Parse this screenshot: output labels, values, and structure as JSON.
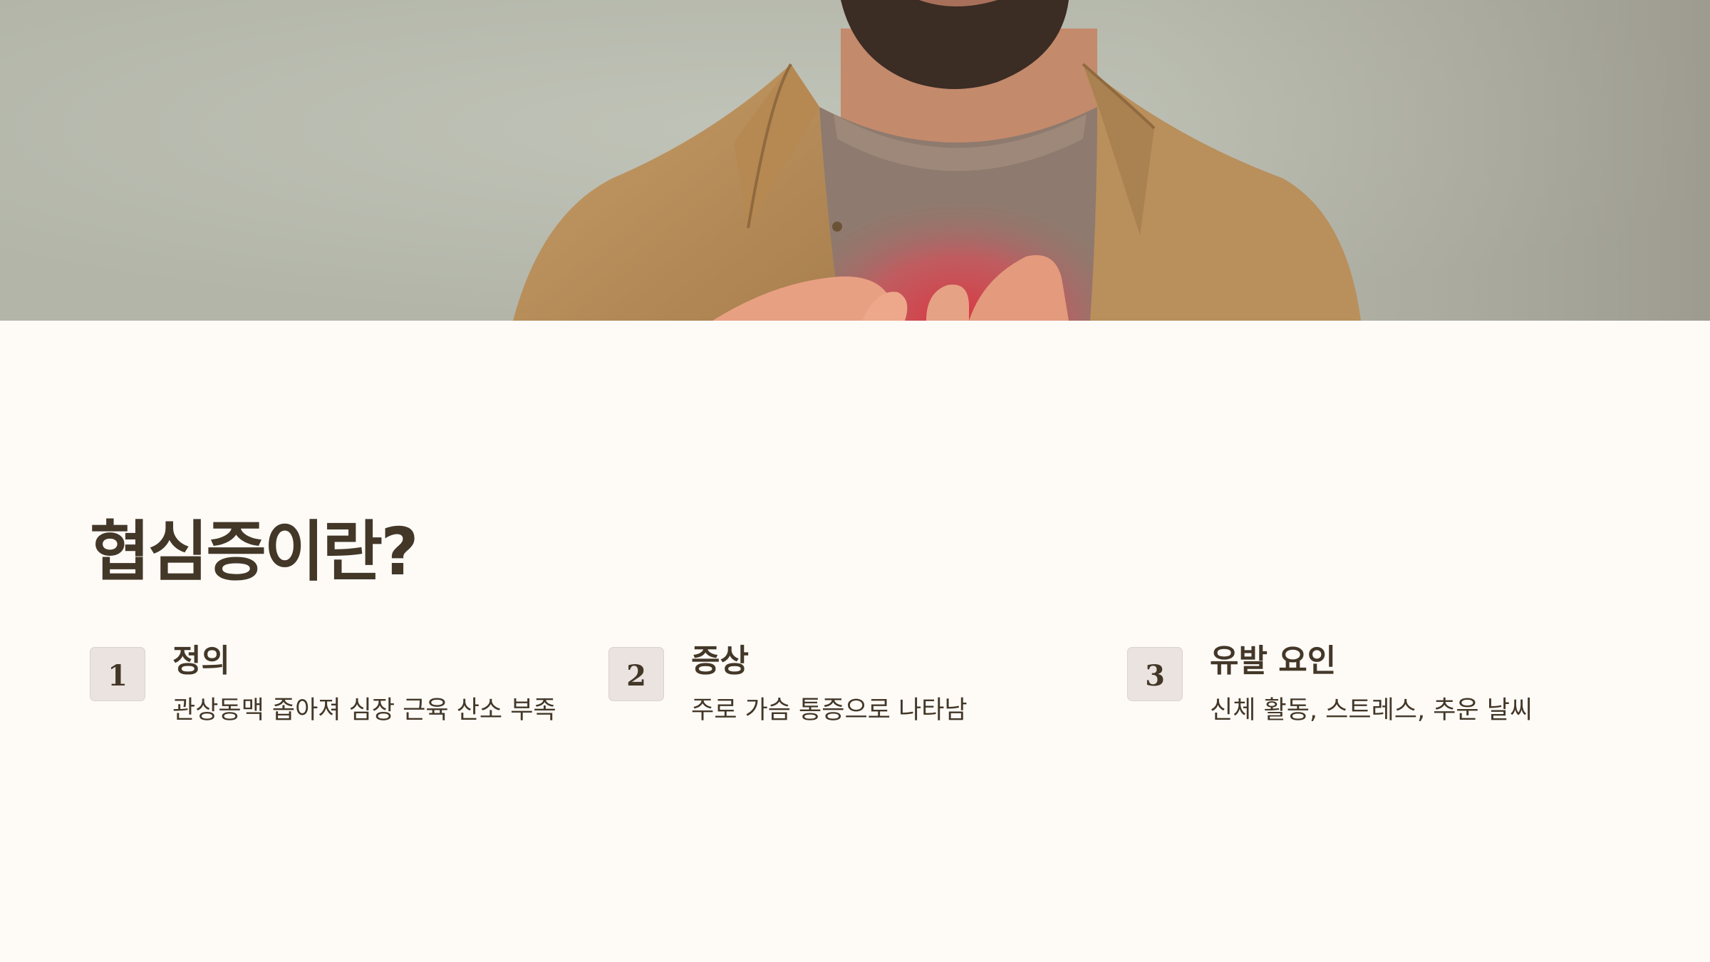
{
  "hero_image": {
    "description_icon": "man-holding-chest-photo",
    "colors": {
      "background": "#b9bbaf",
      "shirt": "#b98f5c",
      "tshirt": "#8e7a6e",
      "skin": "#c88f72",
      "redness": "#d8404a"
    }
  },
  "page": {
    "title": "협심증이란?",
    "background_color": "#fefbf7",
    "text_color": "#433728"
  },
  "items": [
    {
      "number": "1",
      "heading": "정의",
      "description": "관상동맥 좁아져 심장 근육 산소 부족"
    },
    {
      "number": "2",
      "heading": "증상",
      "description": "주로 가슴 통증으로 나타남"
    },
    {
      "number": "3",
      "heading": "유발 요인",
      "description": "신체 활동, 스트레스, 추운 날씨"
    }
  ]
}
